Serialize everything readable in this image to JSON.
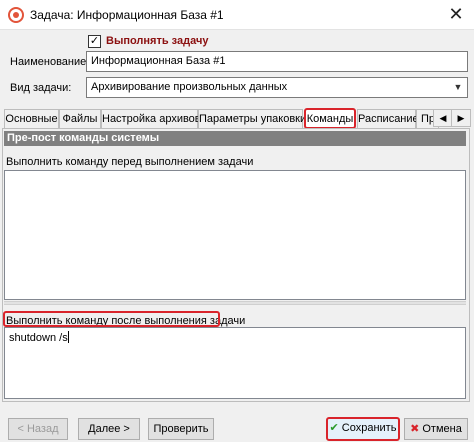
{
  "window": {
    "title": "Задача: Информационная База #1",
    "close_glyph": "✕"
  },
  "form": {
    "enabled_checkbox_label": "Выполнять задачу",
    "enabled_checked": true,
    "name_label": "Наименование:",
    "name_value": "Информационная База #1",
    "type_label": "Вид задачи:",
    "type_value": "Архивирование произвольных данных"
  },
  "tabs": [
    {
      "label": "Основные"
    },
    {
      "label": "Файлы"
    },
    {
      "label": "Настройка архивов"
    },
    {
      "label": "Параметры упаковки"
    },
    {
      "label": "Команды",
      "active": true
    },
    {
      "label": "Расписание"
    },
    {
      "label": "Прервать"
    }
  ],
  "tab_scroll": {
    "left": "◀",
    "right": "▶"
  },
  "commands": {
    "section_title": "Пре-пост команды системы",
    "before_label": "Выполнить команду перед выполнением задачи",
    "before_value": "",
    "after_label": "Выполнить команду после выполнения задачи",
    "after_value": "shutdown /s"
  },
  "buttons": {
    "back": "< Назад",
    "next": "Далее >",
    "check": "Проверить",
    "save": "Сохранить",
    "cancel": "Отмена"
  },
  "icons": {
    "save": "check-icon",
    "cancel": "cancel-x-icon"
  },
  "colors": {
    "highlight": "#d9242b",
    "section_header": "#808080",
    "save_icon": "#2a9a2a",
    "cancel_icon": "#d9242b"
  }
}
